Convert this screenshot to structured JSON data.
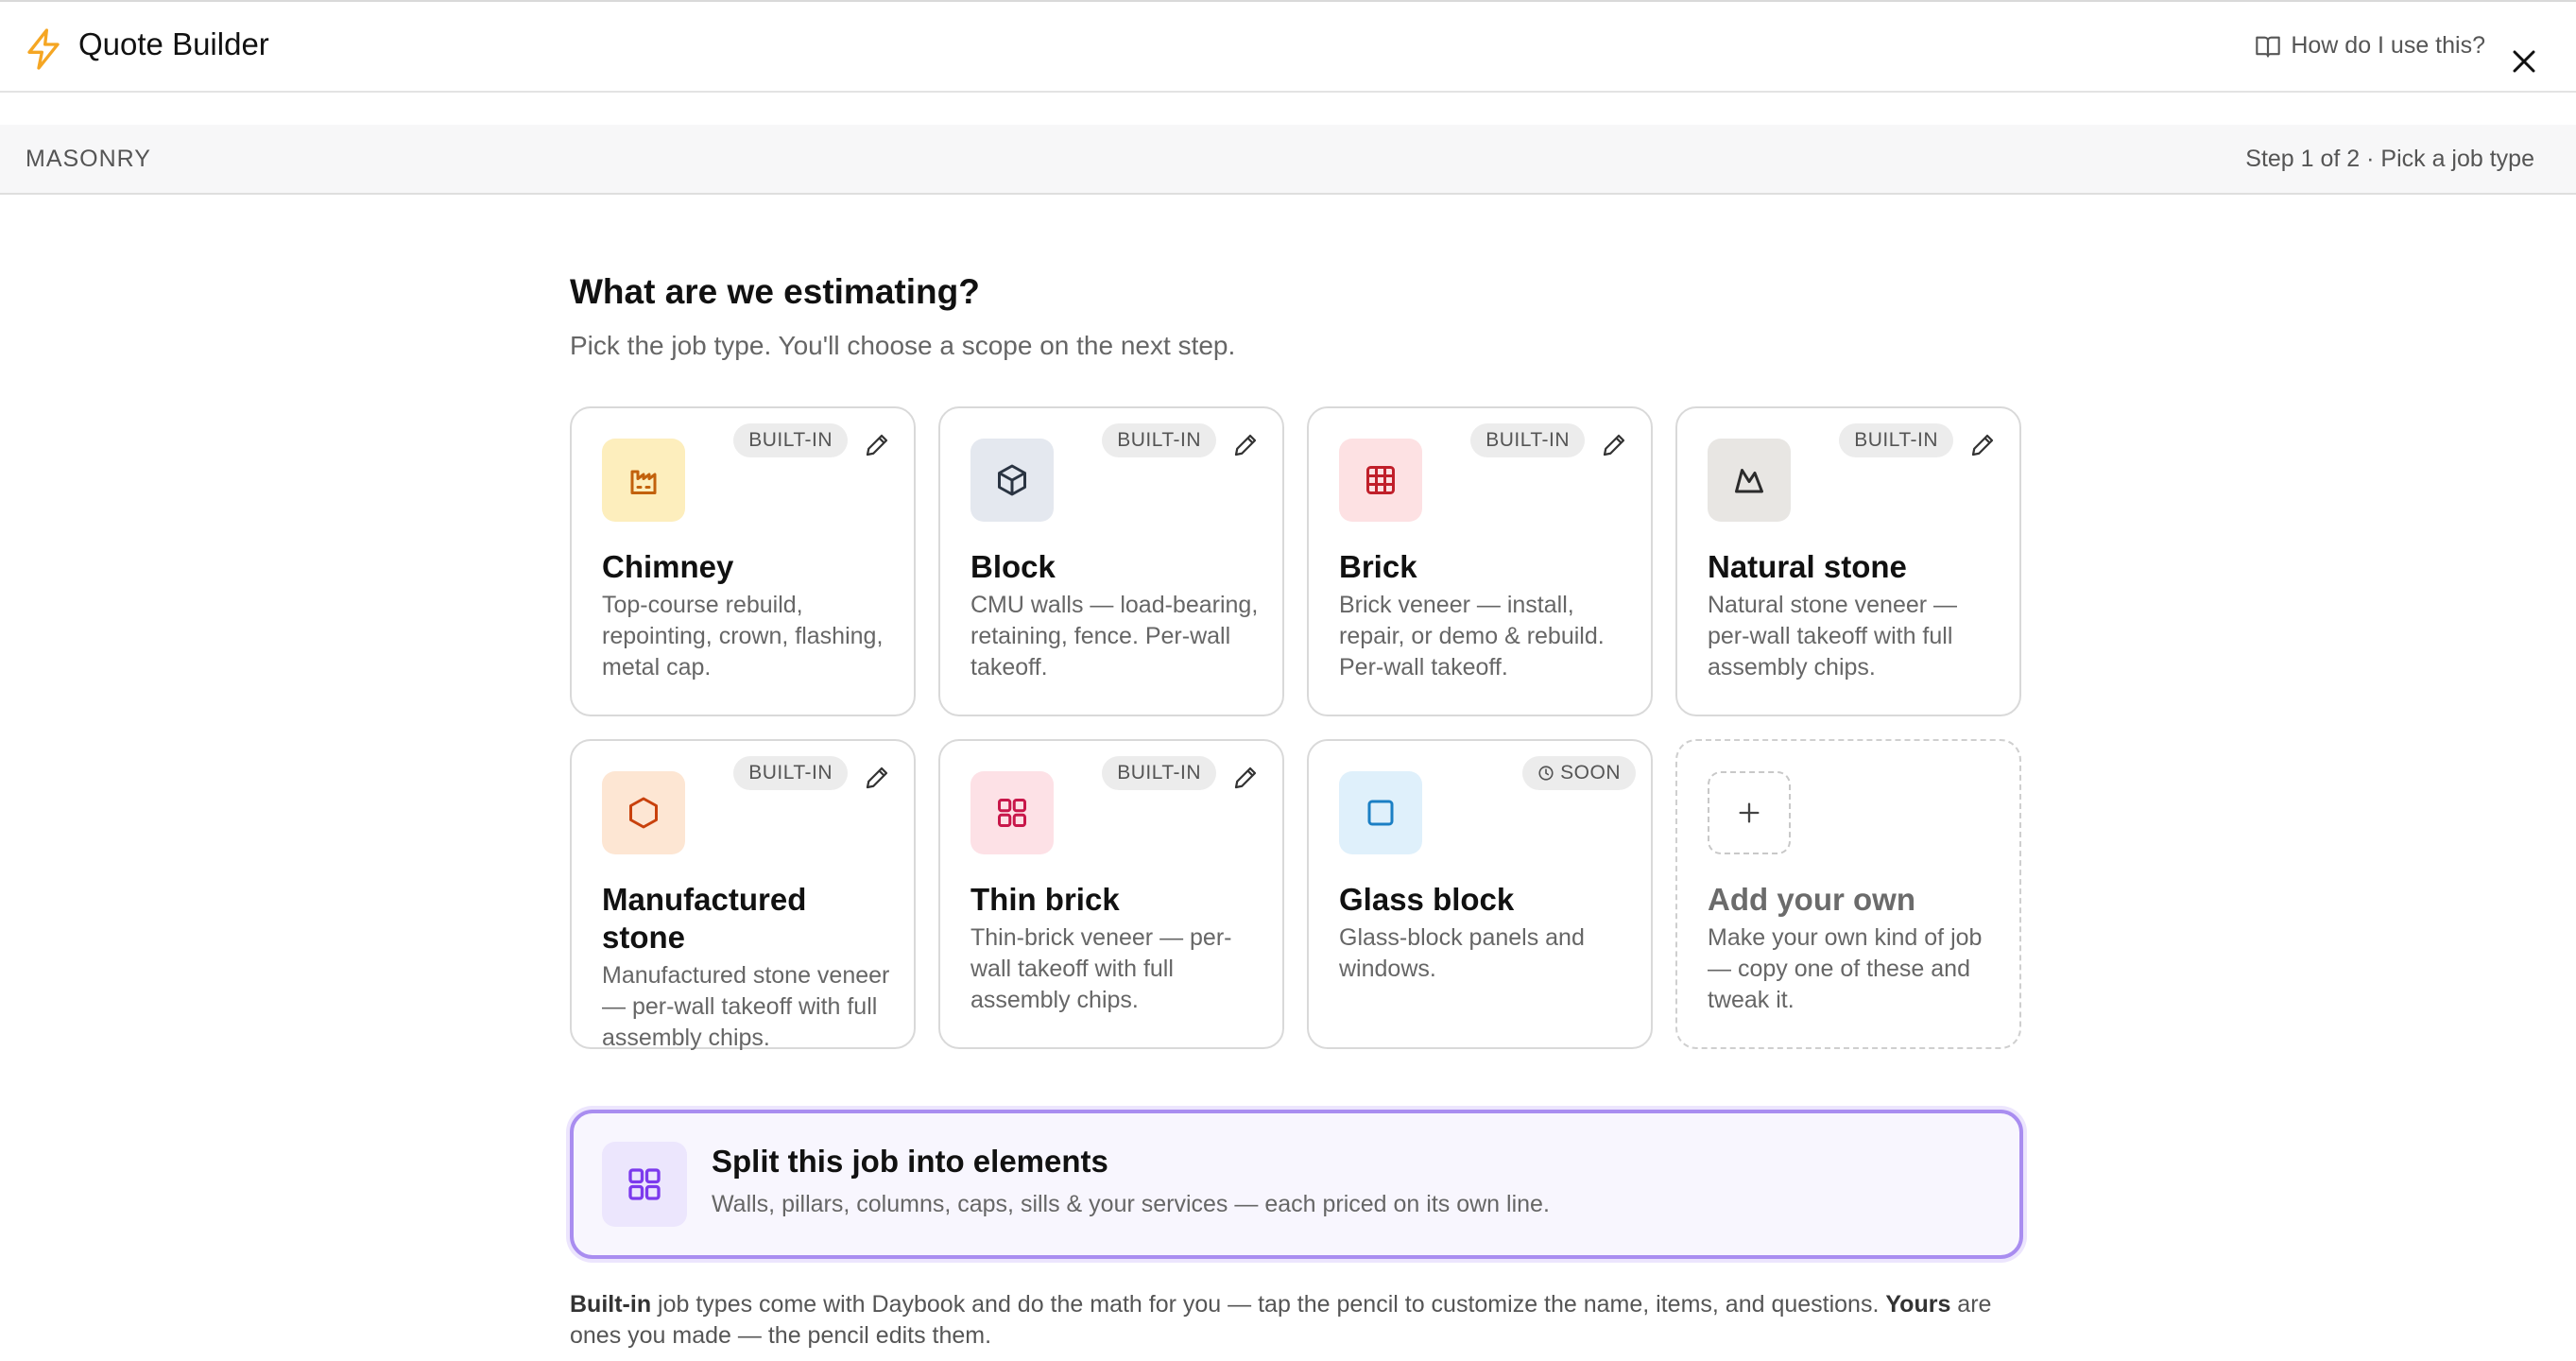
{
  "header": {
    "title": "Quote Builder",
    "help_label": "How do I use this?"
  },
  "subbar": {
    "section": "MASONRY",
    "step": "Step 1 of 2 · Pick a job type"
  },
  "main": {
    "heading": "What are we estimating?",
    "subheading": "Pick the job type. You'll choose a scope on the next step.",
    "cards": [
      {
        "title": "Chimney",
        "desc": "Top-course rebuild, repointing, crown, flashing, metal cap.",
        "badge": "BUILT-IN"
      },
      {
        "title": "Block",
        "desc": "CMU walls — load-bearing, retaining, fence. Per-wall takeoff.",
        "badge": "BUILT-IN"
      },
      {
        "title": "Brick",
        "desc": "Brick veneer — install, repair, or demo & rebuild. Per-wall takeoff.",
        "badge": "BUILT-IN"
      },
      {
        "title": "Natural stone",
        "desc": "Natural stone veneer — per-wall takeoff with full assembly chips.",
        "badge": "BUILT-IN"
      },
      {
        "title": "Manufactured stone",
        "desc": "Manufactured stone veneer — per-wall takeoff with full assembly chips.",
        "badge": "BUILT-IN"
      },
      {
        "title": "Thin brick",
        "desc": "Thin-brick veneer — per-wall takeoff with full assembly chips.",
        "badge": "BUILT-IN"
      },
      {
        "title": "Glass block",
        "desc": "Glass-block panels and windows.",
        "badge": "SOON"
      },
      {
        "title": "Add your own",
        "desc": "Make your own kind of job — copy one of these and tweak it."
      }
    ],
    "split": {
      "title": "Split this job into elements",
      "desc": "Walls, pillars, columns, caps, sills & your services — each priced on its own line."
    },
    "footnote": {
      "b1": "Built-in",
      "t1": " job types come with Daybook and do the math for you — tap the pencil to customize the name, items, and questions. ",
      "b2": "Yours",
      "t2": " are ones you made — the pencil edits them."
    }
  },
  "colors": {
    "accent_bolt": "#f5a623",
    "split_border": "#a98df0",
    "split_bg": "#f8f6fe"
  }
}
